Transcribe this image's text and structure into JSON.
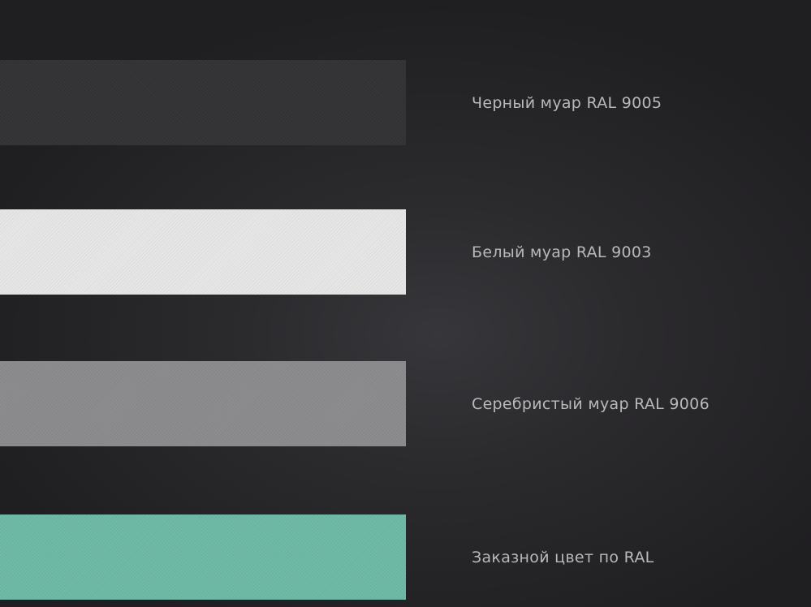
{
  "swatches": [
    {
      "label": "Черный муар RAL 9005",
      "color": "#333335"
    },
    {
      "label": "Белый муар RAL 9003",
      "color": "#e6e6e6"
    },
    {
      "label": "Серебристый муар RAL 9006",
      "color": "#8b8b8d"
    },
    {
      "label": "Заказной цвет по RAL",
      "color": "#6db9a6"
    }
  ]
}
